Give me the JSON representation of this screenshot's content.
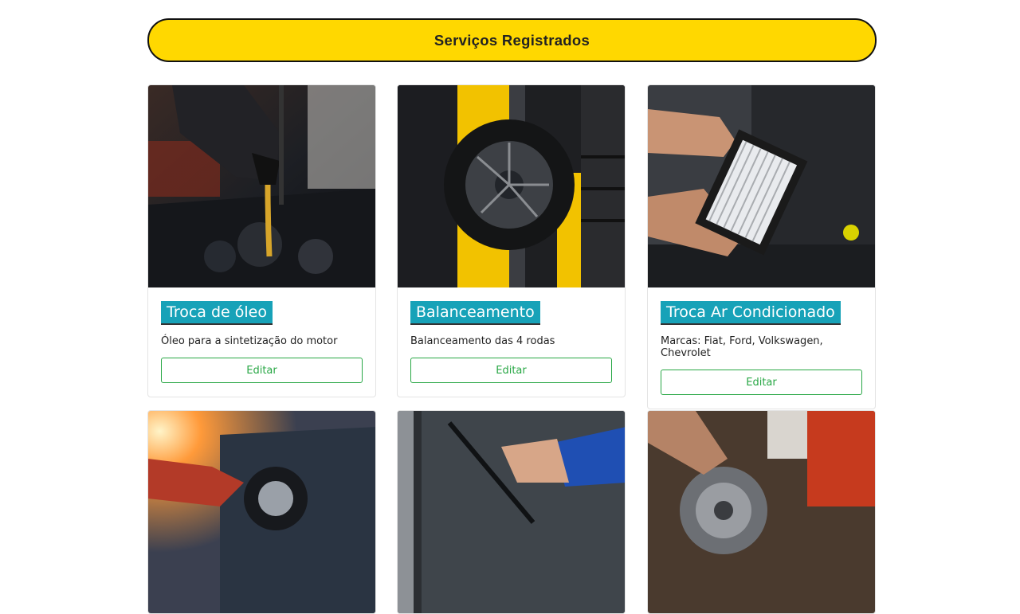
{
  "header": {
    "title": "Serviços Registrados"
  },
  "services": [
    {
      "title": "Troca de óleo",
      "description": "Óleo para a sintetização do motor",
      "button_label": "Editar",
      "image_icon": "oil-change-photo"
    },
    {
      "title": "Balanceamento",
      "description": "Balanceamento das 4 rodas",
      "button_label": "Editar",
      "image_icon": "wheel-balancing-photo"
    },
    {
      "title": "Troca Ar Condicionado",
      "description": "Marcas: Fiat, Ford, Volkswagen, Chevrolet",
      "button_label": "Editar",
      "image_icon": "air-filter-photo"
    }
  ],
  "more_services": [
    {
      "image_icon": "car-wheel-repair-photo"
    },
    {
      "image_icon": "windshield-wiper-photo"
    },
    {
      "image_icon": "clutch-disc-photo"
    }
  ],
  "colors": {
    "header_bg": "#ffd800",
    "title_bg": "#17a2b8",
    "button": "#28a745"
  }
}
